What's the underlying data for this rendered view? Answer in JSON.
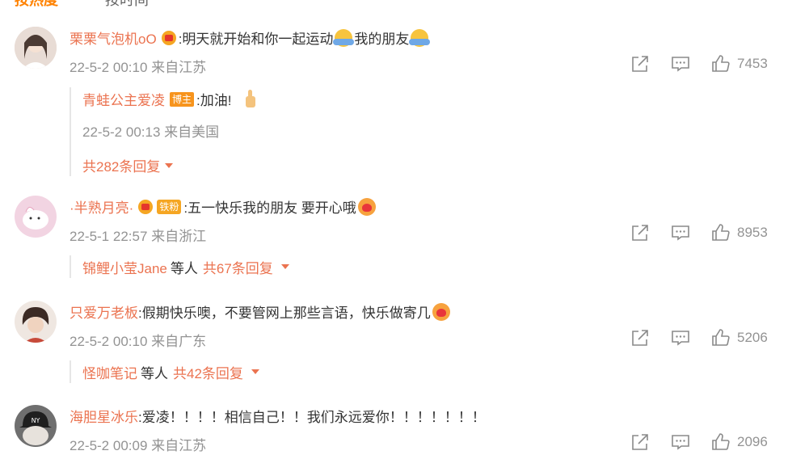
{
  "tabs": {
    "hot": "按热度",
    "time": "按时间"
  },
  "colors": {
    "accent": "#eb7350",
    "meta": "#939393",
    "tab_active": "#ff8200"
  },
  "comments": [
    {
      "user": "栗栗气泡机oO",
      "text": ":明天就开始和你一起运动",
      "text2": "我的朋友",
      "meta": "22-5-2 00:10 来自江苏",
      "likes": "7453",
      "replies": [
        {
          "user": "青蛙公主爱凌",
          "badge": "博主",
          "text": ":加油!",
          "meta": "22-5-2 00:13 来自美国"
        }
      ],
      "more": "共282条回复"
    },
    {
      "user": "·半熟月亮·",
      "badge": "铁粉",
      "text": ":五一快乐我的朋友 要开心哦",
      "meta": "22-5-1 22:57 来自浙江",
      "likes": "8953",
      "reply_summary": {
        "name": "锦鲤小莹Jane",
        "mid": "等人",
        "count": "共67条回复"
      }
    },
    {
      "user": "只爱万老板",
      "text": ":假期快乐噢，不要管网上那些言语，快乐做寄几",
      "meta": "22-5-2 00:10 来自广东",
      "likes": "5206",
      "reply_summary": {
        "name": "怪咖笔记",
        "mid": "等人",
        "count": "共42条回复"
      }
    },
    {
      "user": "海胆星冰乐",
      "text": ":爱凌！！！！相信自己！！我们永远爱你！！！！！！！",
      "meta": "22-5-2 00:09 来自江苏",
      "likes": "2096"
    }
  ]
}
